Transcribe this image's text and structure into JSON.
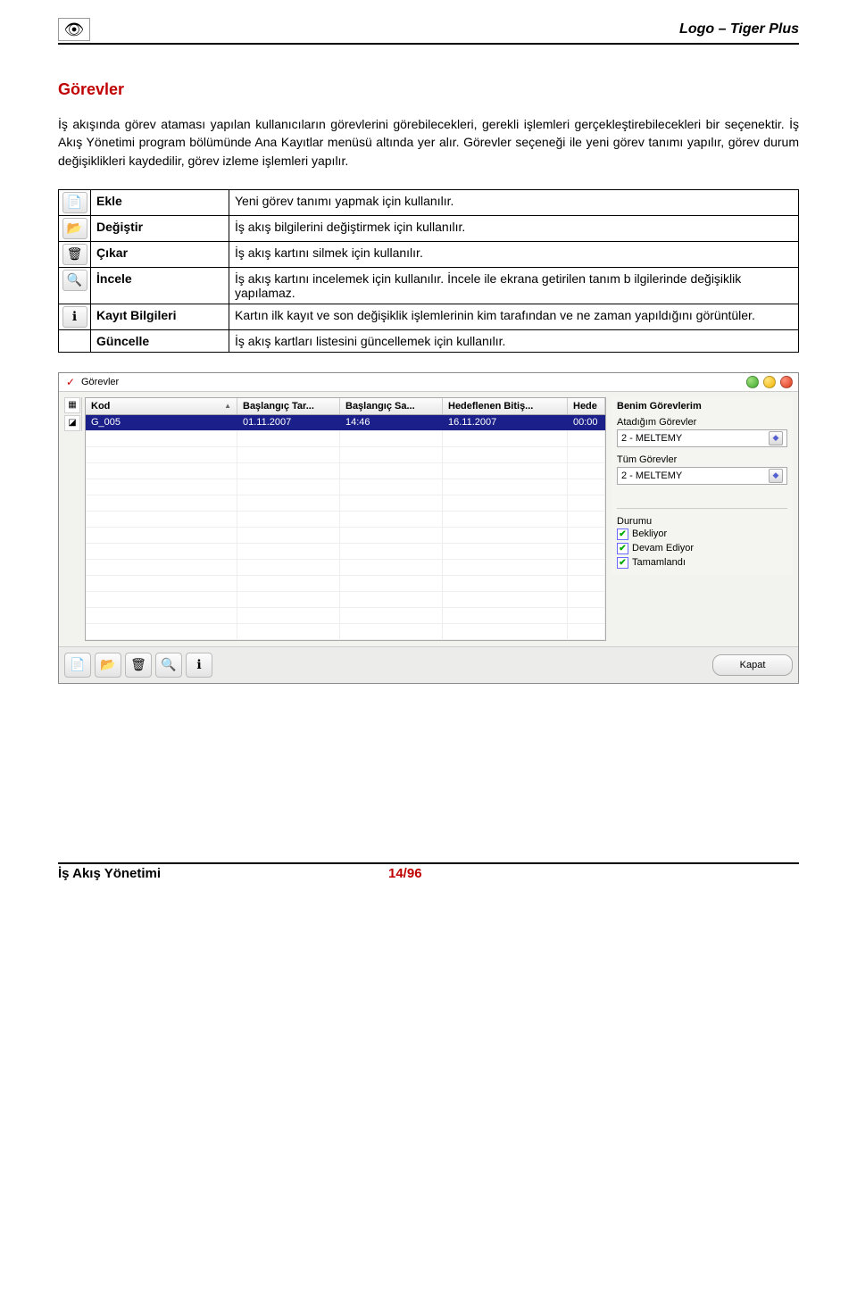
{
  "header": {
    "logo_hint": "eye-logo",
    "title": "Logo – Tiger Plus"
  },
  "section_title": "Görevler",
  "paragraph": "İş akışında görev ataması yapılan kullanıcıların görevlerini görebilecekleri, gerekli işlemleri gerçekleştirebilecekleri bir seçenektir. İş Akış Yönetimi program bölümünde Ana Kayıtlar menüsü altında yer alır. Görevler  seçeneği ile yeni görev tanımı yapılır, görev durum değişiklikleri kaydedilir, görev izleme işlemleri yapılır.",
  "actions": [
    {
      "icon": "📄",
      "icon_name": "add-icon",
      "name": "Ekle",
      "desc": "Yeni görev tanımı yapmak için kullanılır."
    },
    {
      "icon": "📂",
      "icon_name": "edit-icon",
      "name": "Değiştir",
      "desc": "İş akış bilgilerini değiştirmek için kullanılır."
    },
    {
      "icon": "🗑",
      "icon_name": "delete-icon",
      "name": "Çıkar",
      "desc": "İş akış kartını silmek için kullanılır."
    },
    {
      "icon": "🔍",
      "icon_name": "inspect-icon",
      "name": "İncele",
      "desc": "İş akış kartını incelemek için kullanılır. İncele ile ekrana getirilen tanım b ilgilerinde değişiklik yapılamaz."
    },
    {
      "icon": "ℹ",
      "icon_name": "record-info-icon",
      "name": "Kayıt Bilgileri",
      "desc": "Kartın ilk kayıt ve son değişiklik işlemlerinin kim tarafından ve ne zaman yapıldığını görüntüler."
    },
    {
      "icon": "",
      "icon_name": "refresh",
      "name": "Güncelle",
      "desc": "İş akış kartları listesini güncellemek için kullanılır."
    }
  ],
  "window": {
    "title": "Görevler",
    "columns": {
      "kod": "Kod",
      "baslangic_tar": "Başlangıç Tar...",
      "baslangic_sa": "Başlangıç Sa...",
      "hedef_bitis": "Hedeflenen Bitiş...",
      "hede": "Hede"
    },
    "rows": [
      {
        "kod": "G_005",
        "bt": "01.11.2007",
        "bs": "14:46",
        "hb": "16.11.2007",
        "he": "00:00"
      }
    ],
    "panel": {
      "title": "Benim Görevlerim",
      "atadigim_label": "Atadığım Görevler",
      "atadigim_value": "2 - MELTEMY",
      "tum_label": "Tüm Görevler",
      "tum_value": "2 - MELTEMY",
      "durumu_label": "Durumu",
      "durumu": [
        {
          "label": "Bekliyor",
          "checked": true
        },
        {
          "label": "Devam Ediyor",
          "checked": true
        },
        {
          "label": "Tamamlandı",
          "checked": true
        }
      ]
    },
    "close_label": "Kapat",
    "toolbar_icons": [
      "📄",
      "📂",
      "🗑",
      "🔍",
      "ℹ"
    ]
  },
  "footer": {
    "left": "İş Akış Yönetimi",
    "page": "14/96"
  }
}
